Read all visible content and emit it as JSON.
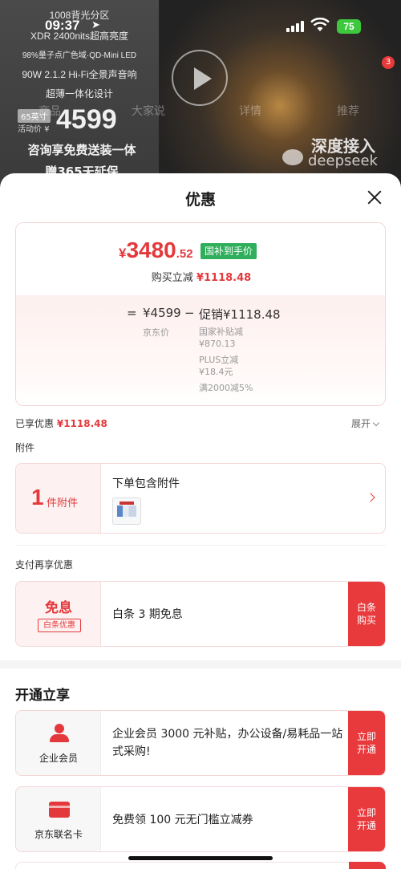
{
  "status_bar": {
    "time": "09:37",
    "battery": "75"
  },
  "background": {
    "banner_lines": [
      "1008背光分区",
      "XDR 2400nits超高亮度",
      "98%量子点广色域·QD-Mini LED",
      "90W 2.1.2 Hi-Fi全景声音响",
      "超薄一体化设计"
    ],
    "size_tag": "65英寸",
    "activity_label": "活动价 ¥",
    "activity_price": "4599",
    "promo_lines": [
      "咨询享免费送装一体",
      "赠365天延保"
    ],
    "tabs": [
      "商品",
      "大家说",
      "详情",
      "推荐"
    ],
    "hero_text_1": "深度接入",
    "hero_text_2": "deepseek",
    "cart_badge": "3"
  },
  "sheet": {
    "title": "优惠",
    "price": {
      "currency": "¥",
      "integer": "3480",
      "decimal": ".52",
      "tag": "国补到手价"
    },
    "buy_cut_label": "购买立减",
    "buy_cut_value": "¥1118.48",
    "breakdown": {
      "equals": "=",
      "jd_price": "¥4599",
      "minus": "−",
      "promo": "促销¥1118.48",
      "jd_label": "京东价",
      "promo_items": [
        [
          "国家补贴减",
          "¥870.13"
        ],
        [
          "PLUS立减",
          "¥18.4元"
        ],
        [
          "满2000减5%",
          ""
        ]
      ]
    },
    "enjoyed_label": "已享优惠",
    "enjoyed_value": "¥1118.48",
    "expand_label": "展开",
    "accessory_section": "附件",
    "accessory": {
      "count": "1",
      "unit": "件附件",
      "title": "下单包含附件"
    },
    "pay_section": "支付再享优惠",
    "baitiao": {
      "title": "免息",
      "sub": "白条优惠",
      "text": "白条 3 期免息",
      "button": [
        "白条",
        "购买"
      ]
    },
    "open_section": "开通立享",
    "members": [
      {
        "label": "企业会员",
        "icon": "person-icon",
        "text": "企业会员 3000 元补贴，办公设备/易耗品一站式采购!",
        "button": [
          "立即",
          "开通"
        ]
      },
      {
        "label": "京东联名卡",
        "icon": "credit-card-icon",
        "text": "免费领 100 元无门槛立减券",
        "button": [
          "立即",
          "开通"
        ]
      }
    ]
  },
  "colors": {
    "accent": "#e4393c",
    "green_tag": "#2fae5b",
    "battery": "#3ec83e"
  }
}
